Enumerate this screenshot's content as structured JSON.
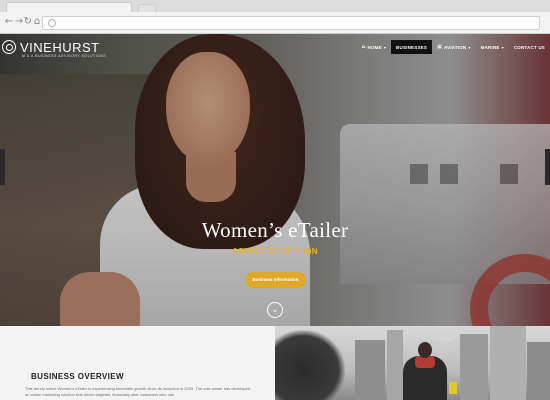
{
  "browser": {
    "nav_icons": [
      "back-arrow-icon",
      "forward-arrow-icon",
      "reload-icon",
      "home-icon"
    ],
    "address": ""
  },
  "header": {
    "logo_text": "VINEHURST",
    "logo_tagline": "M & A BUSINESS ADVISORY SOLUTIONS",
    "nav": [
      {
        "label": "HOME",
        "icon": "home-icon",
        "caret": true,
        "active": false
      },
      {
        "label": "BUSINESSES",
        "icon": "",
        "caret": false,
        "active": true
      },
      {
        "label": "AVIATION",
        "icon": "grid-icon",
        "caret": true,
        "active": false
      },
      {
        "label": "MARINE",
        "icon": "",
        "caret": true,
        "active": false
      },
      {
        "label": "CONTACT US",
        "icon": "",
        "caret": false,
        "active": false
      }
    ]
  },
  "hero": {
    "title": "Women’s eTailer",
    "price": "ASKING $19 MILLION",
    "button_label": "Business Information",
    "scroll_icon": "chevron-down-icon"
  },
  "overview": {
    "title": "BUSINESS OVERVIEW",
    "text": "This trendy online Women’s eTailer is experiencing incredible growth since its inception in 2009. The sole owner has developed an online marketing solution that drives targeted, financially able customers who can"
  },
  "colors": {
    "accent": "#e0a92a",
    "price": "#e3b52a",
    "active_nav": "#111111"
  }
}
